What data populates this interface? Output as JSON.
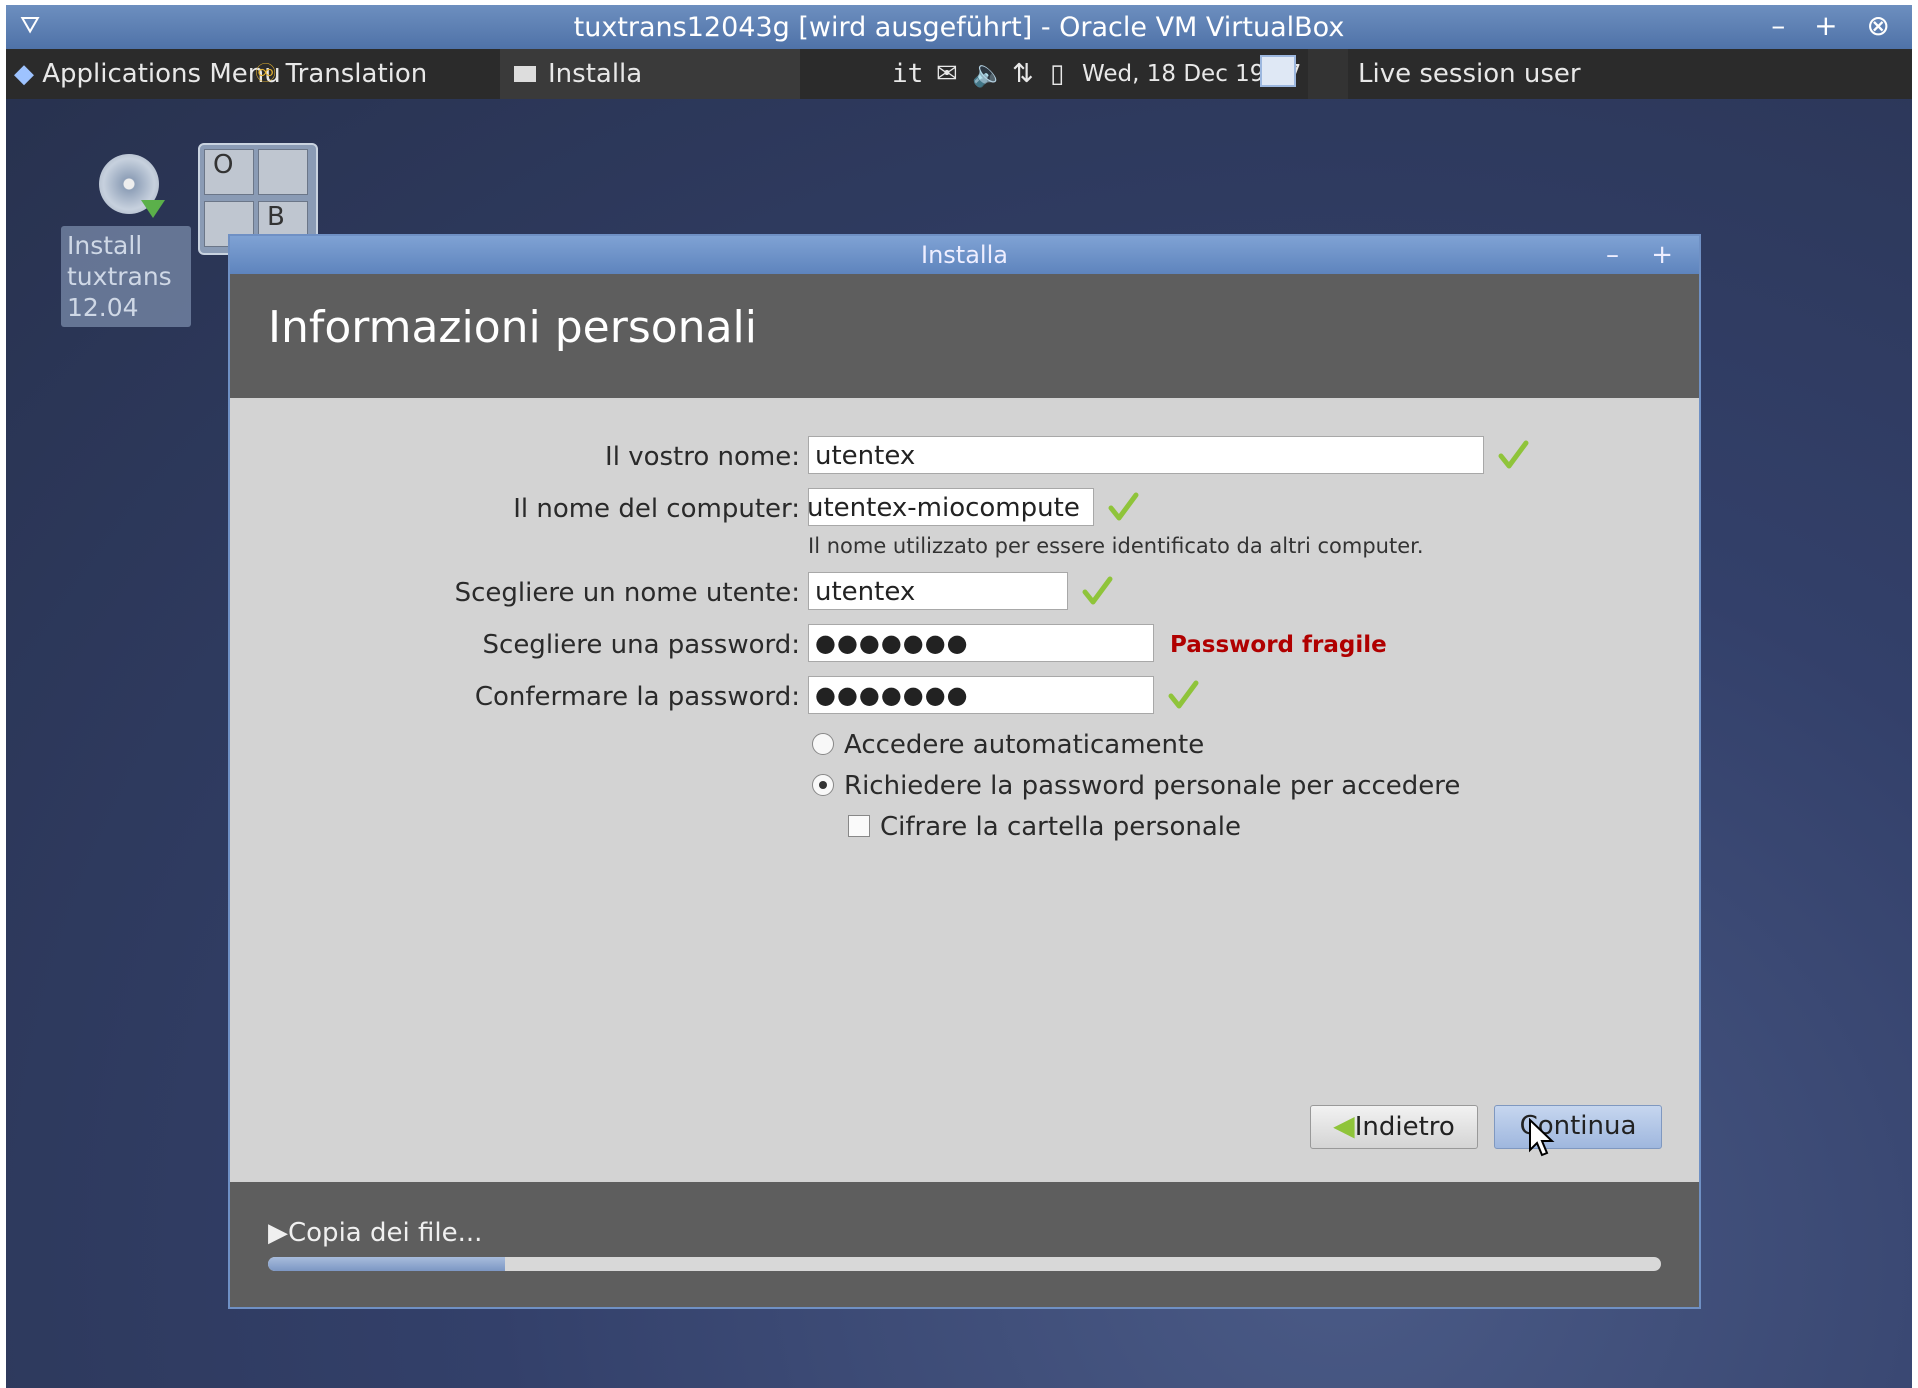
{
  "vbox": {
    "title": "tuxtrans12043g [wird ausgeführt] - Oracle VM VirtualBox",
    "menu_icon": "chevron-down-icon",
    "controls": "– + ⊗"
  },
  "panel": {
    "apps_menu": "Applications Menu",
    "translation": "Translation",
    "task": "Installa",
    "lang": "it",
    "datetime": "Wed, 18 Dec 19:57",
    "user": "Live session user"
  },
  "desktop": {
    "install_label": "Install tuxtrans 12.04",
    "pager": [
      "O",
      "",
      "",
      "B"
    ]
  },
  "dialog": {
    "title": "Installa",
    "controls": "– +",
    "heading": "Informazioni personali",
    "fields": {
      "name_label": "Il vostro nome:",
      "name_value": "utentex",
      "computer_label": "Il nome del computer:",
      "computer_value": "utentex-miocompute",
      "computer_hint": "Il nome utilizzato per essere identificato da altri computer.",
      "username_label": "Scegliere un nome utente:",
      "username_value": "utentex",
      "password_label": "Scegliere una password:",
      "password_value": "●●●●●●●",
      "password_strength": "Password fragile",
      "confirm_label": "Confermare la password:",
      "confirm_value": "●●●●●●●"
    },
    "options": {
      "auto_login": "Accedere automaticamente",
      "require_password": "Richiedere la password personale per accedere",
      "encrypt_home": "Cifrare la cartella personale",
      "selected": "require_password",
      "encrypt_checked": false
    },
    "buttons": {
      "back": "Indietro",
      "continue": "Continua"
    },
    "footer": {
      "status": "Copia dei file...",
      "progress": 0.17
    }
  },
  "colors": {
    "accent": "#6f90c4",
    "weak_password": "#b00000",
    "check": "#8fc43a"
  }
}
